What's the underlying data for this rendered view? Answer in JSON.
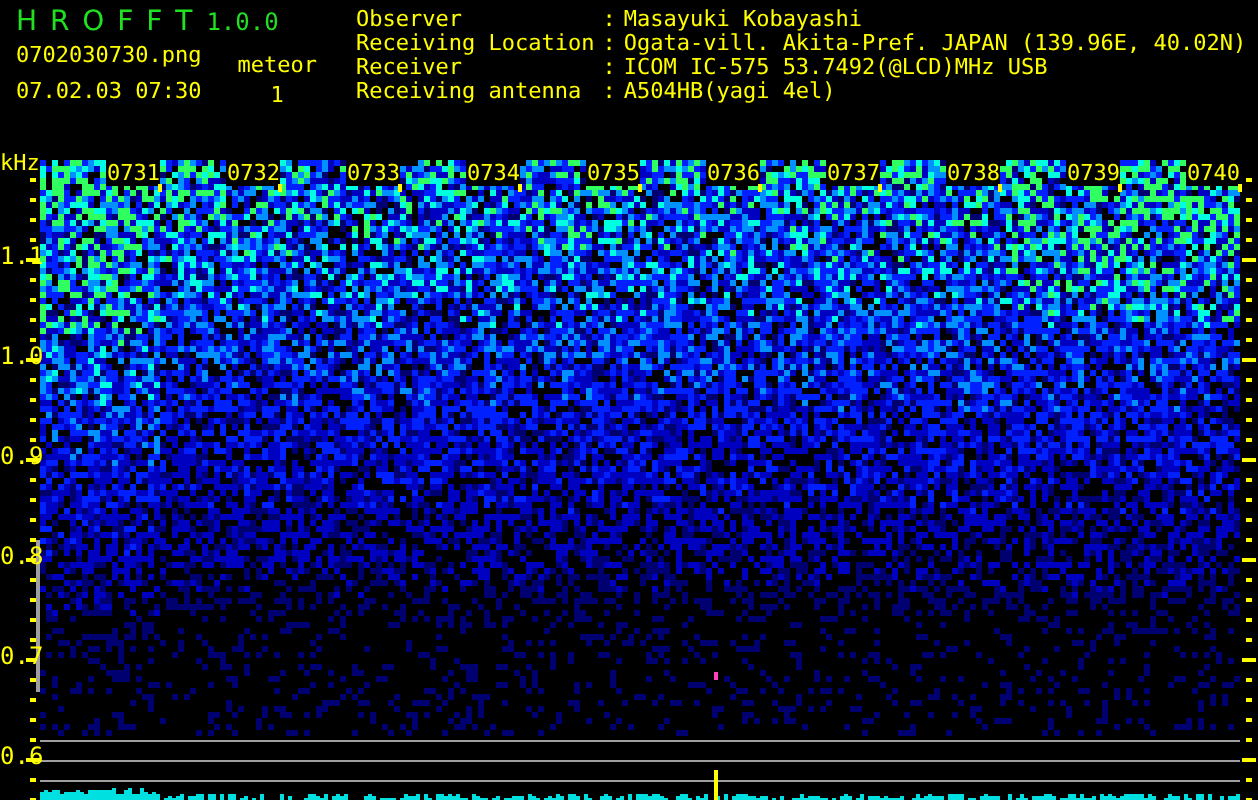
{
  "app": {
    "name": "H R O F F T",
    "version": "1.0.0"
  },
  "file": {
    "filename": "0702030730.png",
    "datetime": "07.02.03 07:30"
  },
  "meteor": {
    "label": "meteor",
    "count": "1"
  },
  "station": [
    {
      "label": "Observer",
      "separator": ":",
      "value": "Masayuki Kobayashi"
    },
    {
      "label": "Receiving Location",
      "separator": ":",
      "value": "Ogata-vill. Akita-Pref. JAPAN (139.96E, 40.02N)"
    },
    {
      "label": "Receiver",
      "separator": ":",
      "value": "ICOM IC-575 53.7492(@LCD)MHz USB"
    },
    {
      "label": "Receiving antenna",
      "separator": ":",
      "value": "A504HB(yagi 4el)"
    }
  ],
  "spectrogram": {
    "unit": "kHz",
    "frequency_labels": [
      "1.1",
      "1.0",
      "0.9",
      "0.8",
      "0.7",
      "0.6"
    ],
    "time_labels": [
      "0731",
      "0732",
      "0733",
      "0734",
      "0735",
      "0736",
      "0737",
      "0738",
      "0739",
      "0740"
    ]
  }
}
